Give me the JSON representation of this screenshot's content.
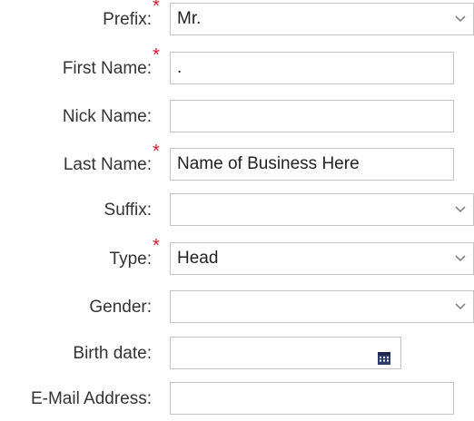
{
  "form": {
    "prefix": {
      "label": "Prefix:",
      "required": "*",
      "value": "Mr."
    },
    "first_name": {
      "label": "First Name:",
      "required": "*",
      "value": "."
    },
    "nick_name": {
      "label": "Nick Name:",
      "value": ""
    },
    "last_name": {
      "label": "Last Name:",
      "required": "*",
      "value": "Name of Business Here"
    },
    "suffix": {
      "label": "Suffix:",
      "value": ""
    },
    "type": {
      "label": "Type:",
      "required": "*",
      "value": "Head"
    },
    "gender": {
      "label": "Gender:",
      "value": ""
    },
    "birth_date": {
      "label": "Birth date:",
      "value": ""
    },
    "email": {
      "label": "E-Mail Address:",
      "value": ""
    }
  },
  "icons": {
    "dropdown": "chevron-down-icon",
    "calendar": "calendar-icon"
  },
  "colors": {
    "required_marker": "#e0162b",
    "border": "#c4c4c4",
    "calendar": "#2b3a67"
  }
}
